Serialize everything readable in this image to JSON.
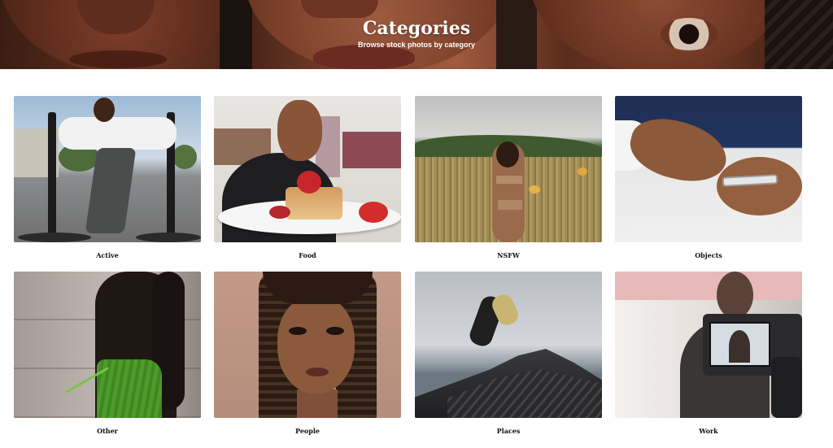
{
  "hero": {
    "title": "Categories",
    "subtitle": "Browse stock photos by category"
  },
  "categories": [
    {
      "label": "Active",
      "icon": "active-photo"
    },
    {
      "label": "Food",
      "icon": "food-photo"
    },
    {
      "label": "NSFW",
      "icon": "nsfw-photo"
    },
    {
      "label": "Objects",
      "icon": "objects-photo"
    },
    {
      "label": "Other",
      "icon": "other-photo"
    },
    {
      "label": "People",
      "icon": "people-photo"
    },
    {
      "label": "Places",
      "icon": "places-photo"
    },
    {
      "label": "Work",
      "icon": "work-photo"
    }
  ],
  "colors": {
    "background": "#ffffff",
    "text": "#111111",
    "hero_text": "#ffffff"
  }
}
